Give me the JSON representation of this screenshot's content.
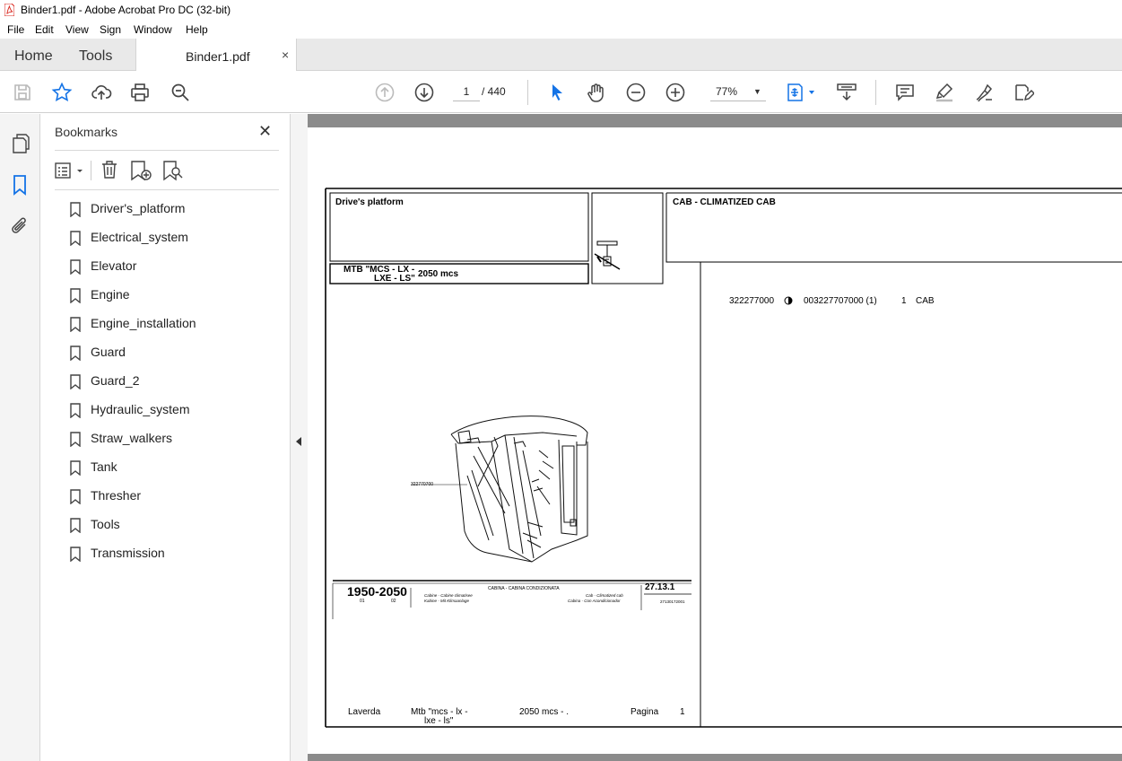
{
  "window": {
    "title": "Binder1.pdf - Adobe Acrobat Pro DC (32-bit)"
  },
  "menu": [
    "File",
    "Edit",
    "View",
    "Sign",
    "Window",
    "Help"
  ],
  "tabs": {
    "home": "Home",
    "tools": "Tools",
    "document": "Binder1.pdf",
    "close": "×"
  },
  "toolbar": {
    "page_current": "1",
    "page_total": "/  440",
    "zoom": "77%",
    "icons": [
      "save-icon",
      "star-icon",
      "upload-icon",
      "print-icon",
      "search-zoom-icon",
      "page-up-icon",
      "page-down-icon",
      "select-cursor-icon",
      "hand-icon",
      "zoom-out-icon",
      "zoom-in-icon",
      "fit-page-icon",
      "scroll-mode-icon",
      "comment-icon",
      "highlight-icon",
      "sign-icon",
      "edit-icon"
    ]
  },
  "bookmarks": {
    "title": "Bookmarks",
    "items": [
      {
        "label": "Driver's_platform"
      },
      {
        "label": "Electrical_system"
      },
      {
        "label": "Elevator"
      },
      {
        "label": "Engine"
      },
      {
        "label": "Engine_installation"
      },
      {
        "label": "Guard"
      },
      {
        "label": "Guard_2"
      },
      {
        "label": "Hydraulic_system"
      },
      {
        "label": "Straw_walkers"
      },
      {
        "label": "Tank"
      },
      {
        "label": "Thresher"
      },
      {
        "label": "Tools"
      },
      {
        "label": "Transmission"
      }
    ]
  },
  "pdf_page": {
    "header_left": "Drive's platform",
    "model_line1": "MTB \"MCS - LX -",
    "model_line2": "LXE - LS\"",
    "model_code": "2050  mcs",
    "header_right": "CAB - CLIMATIZED CAB",
    "part_row": {
      "ref": "322277000",
      "code": "003227707000  (1)",
      "qty": "1",
      "desc": "CAB"
    },
    "drawing_callout": "322770700",
    "titleblock": {
      "model": "1950-2050",
      "num1": "01",
      "num2": "02",
      "center": "CABINA - CABINA CONDIZIONATA",
      "left_sub1": "Cabine - Cabine climatisee",
      "left_sub2": "Kabine - Mit Klimaanlage",
      "right_sub1": "Cab - Climatized cab",
      "right_sub2": "Cabina - Con Acondicionador",
      "ref": "27.13.1",
      "code": "27130172001"
    },
    "footer": {
      "brand": "Laverda",
      "model_line1": "Mtb \"mcs - lx -",
      "model_line2": "lxe - ls\"",
      "code": "2050  mcs - .",
      "page_label": "Pagina",
      "page_num": "1"
    }
  },
  "colors": {
    "accent": "#1473e6",
    "pdf_red": "#d9251c",
    "doc_bg": "#8b8b8b"
  }
}
